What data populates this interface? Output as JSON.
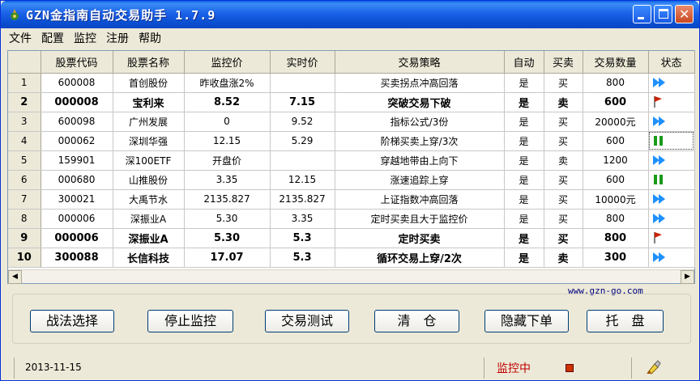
{
  "window": {
    "title": "GZN金指南自动交易助手 1.7.9"
  },
  "menu": [
    "文件",
    "配置",
    "监控",
    "注册",
    "帮助"
  ],
  "grid": {
    "columns": [
      "",
      "股票代码",
      "股票名称",
      "监控价",
      "实时价",
      "交易策略",
      "自动",
      "买卖",
      "交易数量",
      "状态"
    ],
    "rows": [
      {
        "num": "1",
        "code": "600008",
        "name": "首创股份",
        "monitor": "昨收盘涨2%",
        "realtime": "",
        "strategy": "买卖拐点冲高回落",
        "auto": "是",
        "side": "买",
        "qty": "800",
        "status": "play-icon",
        "bold": false
      },
      {
        "num": "2",
        "code": "000008",
        "name": "宝利来",
        "monitor": "8.52",
        "realtime": "7.15",
        "strategy": "突破交易下破",
        "auto": "是",
        "side": "卖",
        "qty": "600",
        "status": "flag-icon",
        "bold": true
      },
      {
        "num": "3",
        "code": "600098",
        "name": "广州发展",
        "monitor": "0",
        "realtime": "9.52",
        "strategy": "指标公式/3份",
        "auto": "是",
        "side": "买",
        "qty": "20000元",
        "status": "play-icon",
        "bold": false
      },
      {
        "num": "4",
        "code": "000062",
        "name": "深圳华强",
        "monitor": "12.15",
        "realtime": "5.29",
        "strategy": "阶梯买卖上穿/3次",
        "auto": "是",
        "side": "买",
        "qty": "600",
        "status": "pause-icon",
        "bold": false
      },
      {
        "num": "5",
        "code": "159901",
        "name": "深100ETF",
        "monitor": "开盘价",
        "realtime": "",
        "strategy": "穿越地带由上向下",
        "auto": "是",
        "side": "卖",
        "qty": "1200",
        "status": "play-icon",
        "bold": false
      },
      {
        "num": "6",
        "code": "000680",
        "name": "山推股份",
        "monitor": "3.35",
        "realtime": "12.15",
        "strategy": "涨速追踪上穿",
        "auto": "是",
        "side": "买",
        "qty": "600",
        "status": "pause-icon",
        "bold": false
      },
      {
        "num": "7",
        "code": "300021",
        "name": "大禹节水",
        "monitor": "2135.827",
        "realtime": "2135.827",
        "strategy": "上证指数冲高回落",
        "auto": "是",
        "side": "买",
        "qty": "10000元",
        "status": "play-icon",
        "bold": false
      },
      {
        "num": "8",
        "code": "000006",
        "name": "深振业A",
        "monitor": "5.30",
        "realtime": "3.35",
        "strategy": "定时买卖且大于监控价",
        "auto": "是",
        "side": "买",
        "qty": "800",
        "status": "play-icon",
        "bold": false
      },
      {
        "num": "9",
        "code": "000006",
        "name": "深振业A",
        "monitor": "5.30",
        "realtime": "5.3",
        "strategy": "定时买卖",
        "auto": "是",
        "side": "买",
        "qty": "800",
        "status": "flag-icon",
        "bold": true
      },
      {
        "num": "10",
        "code": "300088",
        "name": "长信科技",
        "monitor": "17.07",
        "realtime": "5.3",
        "strategy": "循环交易上穿/2次",
        "auto": "是",
        "side": "卖",
        "qty": "300",
        "status": "play-icon",
        "bold": true
      }
    ]
  },
  "website": "www.gzn-go.com",
  "buttons": {
    "strategy_select": "战法选择",
    "stop_monitor": "停止监控",
    "trade_test": "交易测试",
    "clear_position": "清　仓",
    "hide_order": "隐藏下单",
    "tray": "托　盘"
  },
  "statusbar": {
    "date": "2013-11-15",
    "monitor_state": "监控中"
  },
  "colors": {
    "title_bar": "#0a4fd0",
    "play_icon": "#1e90ff",
    "pause_icon": "#1a9a1a",
    "flag_icon": "#cc2200",
    "monitor_state": "#c00000"
  }
}
